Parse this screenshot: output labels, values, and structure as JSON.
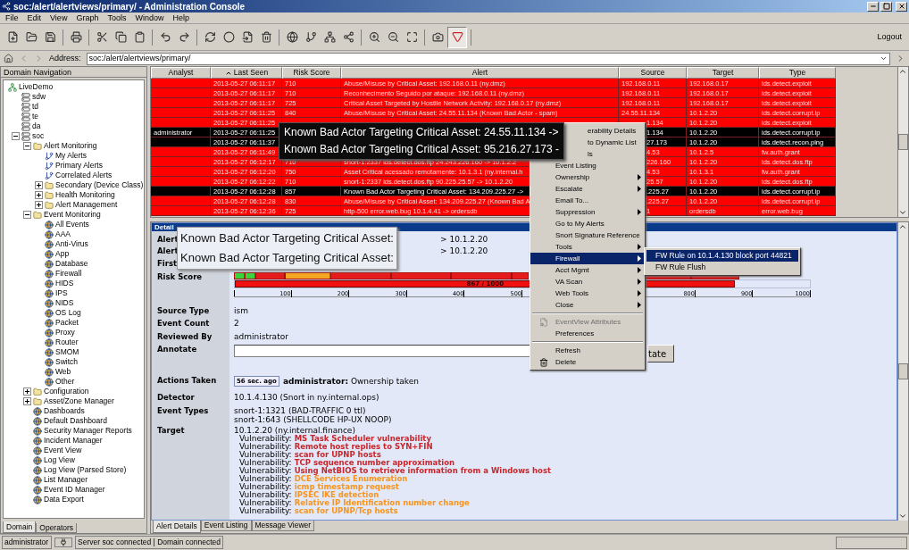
{
  "window": {
    "title": "soc:/alert/alertviews/primary/ - Administration Console"
  },
  "menubar": [
    "File",
    "Edit",
    "View",
    "Graph",
    "Tools",
    "Window",
    "Help"
  ],
  "toolbar": {
    "graph_toggle_on": true,
    "logout": "Logout"
  },
  "address": {
    "label": "Address:",
    "value": "soc:/alert/alertviews/primary/"
  },
  "navigation": {
    "title": "Domain Navigation",
    "tree": [
      {
        "label": "LiveDemo",
        "kind": "root",
        "children": [
          {
            "label": "sdw",
            "kind": "host"
          },
          {
            "label": "td",
            "kind": "host"
          },
          {
            "label": "te",
            "kind": "host"
          },
          {
            "label": "da",
            "kind": "host"
          },
          {
            "label": "soc",
            "kind": "host",
            "expanded": true,
            "children": [
              {
                "label": "Alert Monitoring",
                "kind": "folder",
                "expanded": true,
                "children": [
                  {
                    "label": "My Alerts",
                    "kind": "alert_view"
                  },
                  {
                    "label": "Primary Alerts",
                    "kind": "alert_view"
                  },
                  {
                    "label": "Correlated Alerts",
                    "kind": "alert_view"
                  },
                  {
                    "label": "Secondary (Device Class)",
                    "kind": "folder",
                    "expanded": false
                  },
                  {
                    "label": "Health Monitoring",
                    "kind": "folder",
                    "expanded": false
                  },
                  {
                    "label": "Alert Management",
                    "kind": "folder",
                    "expanded": false
                  }
                ]
              },
              {
                "label": "Event Monitoring",
                "kind": "folder",
                "expanded": true,
                "children": [
                  {
                    "label": "All Events",
                    "kind": "event_view"
                  },
                  {
                    "label": "AAA",
                    "kind": "event_view"
                  },
                  {
                    "label": "Anti-Virus",
                    "kind": "event_view"
                  },
                  {
                    "label": "App",
                    "kind": "event_view"
                  },
                  {
                    "label": "Database",
                    "kind": "event_view"
                  },
                  {
                    "label": "Firewall",
                    "kind": "event_view"
                  },
                  {
                    "label": "HIDS",
                    "kind": "event_view"
                  },
                  {
                    "label": "IPS",
                    "kind": "event_view"
                  },
                  {
                    "label": "NIDS",
                    "kind": "event_view"
                  },
                  {
                    "label": "OS Log",
                    "kind": "event_view"
                  },
                  {
                    "label": "Packet",
                    "kind": "event_view"
                  },
                  {
                    "label": "Proxy",
                    "kind": "event_view"
                  },
                  {
                    "label": "Router",
                    "kind": "event_view"
                  },
                  {
                    "label": "SMOM",
                    "kind": "event_view"
                  },
                  {
                    "label": "Switch",
                    "kind": "event_view"
                  },
                  {
                    "label": "Web",
                    "kind": "event_view"
                  },
                  {
                    "label": "Other",
                    "kind": "event_view"
                  }
                ]
              },
              {
                "label": "Configuration",
                "kind": "folder",
                "expanded": false
              },
              {
                "label": "Asset/Zone Manager",
                "kind": "folder",
                "expanded": false
              },
              {
                "label": "Dashboards",
                "kind": "event_view"
              },
              {
                "label": "Default Dashboard",
                "kind": "event_view"
              },
              {
                "label": "Security Manager Reports",
                "kind": "event_view"
              },
              {
                "label": "Incident Manager",
                "kind": "event_view"
              },
              {
                "label": "Event View",
                "kind": "event_view"
              },
              {
                "label": "Log View",
                "kind": "event_view"
              },
              {
                "label": "Log View (Parsed Store)",
                "kind": "event_view"
              },
              {
                "label": "List Manager",
                "kind": "event_view"
              },
              {
                "label": "Event ID Manager",
                "kind": "event_view"
              },
              {
                "label": "Data Export",
                "kind": "event_view"
              }
            ]
          }
        ]
      }
    ],
    "tabs": [
      {
        "label": "Domain",
        "selected": true
      },
      {
        "label": "Operators",
        "selected": false
      }
    ]
  },
  "table": {
    "columns": [
      {
        "label": "Analyst",
        "sorted": false
      },
      {
        "label": "Last Seen",
        "sorted": true
      },
      {
        "label": "Risk Score",
        "sorted": false
      },
      {
        "label": "Alert",
        "sorted": false
      },
      {
        "label": "Source",
        "sorted": false
      },
      {
        "label": "Target",
        "sorted": false
      },
      {
        "label": "Type",
        "sorted": false
      }
    ],
    "rows": [
      {
        "selected": false,
        "last_seen": "2013-05-27 06:11:17",
        "risk_score": "710",
        "alert": "Abuse/Misuse by Critical Asset: 192.168.0.11 (ny.dmz)",
        "source": "192.168.0.11",
        "target": "192.168.0.17",
        "type": "ids.detect.exploit"
      },
      {
        "selected": false,
        "last_seen": "2013-05-27 06:11:17",
        "risk_score": "710",
        "alert": "Reconhecimento Seguido por ataque: 192.168.0.11 (ny.dmz)",
        "source": "192.168.0.11",
        "target": "192.168.0.17",
        "type": "ids.detect.exploit"
      },
      {
        "selected": false,
        "last_seen": "2013-05-27 06:11:17",
        "risk_score": "725",
        "alert": "Critical Asset Targeted by Hostile Network Activity: 192.168.0.17 (ny.dmz)",
        "source": "192.168.0.11",
        "target": "192.168.0.17",
        "type": "ids.detect.exploit"
      },
      {
        "selected": false,
        "last_seen": "2013-05-27 06:11:25",
        "risk_score": "840",
        "alert": "Abuse/Misuse by Critical Asset: 24.55.11.134 (Known Bad Actor - spam)",
        "source": "24.55.11.134",
        "target": "10.1.2.20",
        "type": "ids.detect.corrupt.ip"
      },
      {
        "selected": false,
        "last_seen": "2013-05-27 06:11:25",
        "source": "1.134",
        "target": "10.1.2.20",
        "type": "ids.detect.exploit"
      },
      {
        "selected": true,
        "analyst": "administrator",
        "last_seen": "2013-05-27 06:11:25",
        "source": "1.134",
        "target": "10.1.2.20",
        "type": "ids.detect.corrupt.ip"
      },
      {
        "selected": true,
        "last_seen": "2013-05-27 06:11:37",
        "source": "27.173",
        "target": "10.1.2.20",
        "type": "ids.detect.recon.ping"
      },
      {
        "selected": false,
        "last_seen": "2013-05-27 06:11:49",
        "source": "4.53",
        "target": "10.1.2.5",
        "type": "fw.auth.grant"
      },
      {
        "selected": false,
        "last_seen": "2013-05-27 06:12:17",
        "risk_score": "710",
        "alert": "snort-1:2337 ids.detect.dos.ftp 24.243.226.160 -> 10.1.2.2",
        "source": "226.160",
        "target": "10.1.2.20",
        "type": "ids.detect.dos.ftp"
      },
      {
        "selected": false,
        "last_seen": "2013-05-27 06:12:20",
        "risk_score": "750",
        "alert": "Asset Critical acessado remotamente: 10.1.3.1 (ny.internal.h",
        "source": "4.53",
        "target": "10.1.3.1",
        "type": "fw.auth.grant"
      },
      {
        "selected": false,
        "last_seen": "2013-05-27 06:12:22",
        "risk_score": "710",
        "alert": "snort-1:2337 ids.detect.dos.ftp 90.225.25.57 -> 10.1.2.20",
        "source": "25.57",
        "target": "10.1.2.20",
        "type": "ids.detect.dos.ftp"
      },
      {
        "selected": true,
        "last_seen": "2013-05-27 06:12:28",
        "risk_score": "857",
        "alert": "Known Bad Actor Targeting Critical Asset: 134.209.225.27 ->",
        "source": ".225.27",
        "target": "10.1.2.20",
        "type": "ids.detect.corrupt.ip"
      },
      {
        "selected": false,
        "last_seen": "2013-05-27 06:12:28",
        "risk_score": "830",
        "alert": "Abuse/Misuse by Critical Asset: 134.209.225.27 (Known Bad A",
        "source": ".225.27",
        "target": "10.1.2.20",
        "type": "ids.detect.corrupt.ip"
      },
      {
        "selected": false,
        "last_seen": "2013-05-27 06:12:36",
        "risk_score": "725",
        "alert": "http-500 error.web.bug 10.1.4.41 -> ordersdb",
        "source": "1",
        "target": "ordersdb",
        "type": "error.web.bug"
      }
    ]
  },
  "details": {
    "title": "Detail",
    "rows": [
      {
        "kind": "covered",
        "label": "Alert",
        "value": "> 10.1.2.20"
      },
      {
        "kind": "covered",
        "label": "Alert",
        "value": "> 10.1.2.20"
      },
      {
        "kind": "covered",
        "label": "First"
      },
      {
        "kind": "meter",
        "label": "Risk Score",
        "level": 0.867,
        "reading": "867 / 1000",
        "ticks": [
          "100",
          "200",
          "300",
          "400",
          "500",
          "800",
          "900",
          "1000"
        ]
      },
      {
        "kind": "text",
        "label": "Source Type",
        "value": "ism"
      },
      {
        "kind": "text",
        "label": "Event Count",
        "value": "2"
      },
      {
        "kind": "text",
        "label": "Reviewed By",
        "value": "administrator"
      },
      {
        "kind": "annotate",
        "label": "Annotate",
        "button": "tate"
      },
      {
        "kind": "actions",
        "label": "Actions Taken",
        "age": "56 sec. ago",
        "value": "**administrator:** Ownership taken"
      },
      {
        "kind": "text",
        "label": "Detector",
        "value": "10.1.4.130 (Snort in ny.internal.ops)"
      },
      {
        "kind": "lines",
        "label": "Event Types",
        "lines": [
          "snort-1:1321 (BAD-TRAFFIC 0 ttl)",
          "snort-1:643 (SHELLCODE HP-UX NOOP)"
        ]
      },
      {
        "kind": "target",
        "label": "Target",
        "value": "10.1.2.20 (ny.internal.finance)",
        "vulnerabilities": [
          {
            "label": "Vulnerability:",
            "name": "MS Task Scheduler vulnerability",
            "color": "#c8262b"
          },
          {
            "label": "Vulnerability:",
            "name": "Remote host replies to SYN+FIN",
            "color": "#c8262b"
          },
          {
            "label": "Vulnerability:",
            "name": "scan for UPNP hosts",
            "color": "#c8262b"
          },
          {
            "label": "Vulnerability:",
            "name": "TCP sequence number approximation",
            "color": "#c8262b"
          },
          {
            "label": "Vulnerability:",
            "name": "Using NetBIOS to retrieve information from a Windows host",
            "color": "#c8262b"
          },
          {
            "label": "Vulnerability:",
            "name": "DCE Services Enumeration",
            "color": "#f7941d"
          },
          {
            "label": "Vulnerability:",
            "name": "icmp timestamp request",
            "color": "#f7941d"
          },
          {
            "label": "Vulnerability:",
            "name": "IPSEC IKE detection",
            "color": "#f7941d"
          },
          {
            "label": "Vulnerability:",
            "name": "Relative IP Identification number change",
            "color": "#f7941d"
          },
          {
            "label": "Vulnerability:",
            "name": "scan for UPNP/Tcp hosts",
            "color": "#f7941d"
          }
        ]
      }
    ]
  },
  "detail_tabs": [
    {
      "label": "Alert Details",
      "selected": true
    },
    {
      "label": "Event Listing",
      "selected": false
    },
    {
      "label": "Message Viewer",
      "selected": false
    }
  ],
  "tooltips": [
    {
      "kind": "dark",
      "lines": [
        "Known Bad Actor Targeting Critical Asset: 24.55.11.134 ->",
        "Known Bad Actor Targeting Critical Asset: 95.216.27.173 -"
      ]
    },
    {
      "kind": "light",
      "lines": [
        "Known Bad Actor Targeting Critical Asset:",
        "Known Bad Actor Targeting Critical Asset:"
      ]
    }
  ],
  "context_menu": {
    "items": [
      {
        "kind": "item",
        "label": "erability Details",
        "selected": false,
        "disabled": false
      },
      {
        "kind": "item",
        "label": "to Dynamic List",
        "selected": false,
        "disabled": false
      },
      {
        "kind": "item",
        "label": "ls",
        "selected": false,
        "disabled": false
      },
      {
        "kind": "item",
        "label": "Event Listing",
        "selected": false,
        "disabled": false
      },
      {
        "kind": "submenu",
        "label": "Ownership",
        "selected": false,
        "disabled": false
      },
      {
        "kind": "submenu",
        "label": "Escalate",
        "selected": false,
        "disabled": false
      },
      {
        "kind": "item",
        "label": "Email To...",
        "selected": false,
        "disabled": false
      },
      {
        "kind": "submenu",
        "label": "Suppression",
        "selected": false,
        "disabled": false
      },
      {
        "kind": "item",
        "label": "Go to My Alerts",
        "selected": false,
        "disabled": false
      },
      {
        "kind": "item",
        "label": "Snort Signature Reference",
        "selected": false,
        "disabled": false
      },
      {
        "kind": "submenu",
        "label": "Tools",
        "selected": false,
        "disabled": false
      },
      {
        "kind": "submenu",
        "label": "Firewall",
        "selected": true,
        "disabled": false
      },
      {
        "kind": "submenu",
        "label": "Acct Mgmt",
        "selected": false,
        "disabled": false
      },
      {
        "kind": "submenu",
        "label": "VA Scan",
        "selected": false,
        "disabled": false
      },
      {
        "kind": "submenu",
        "label": "Web Tools",
        "selected": false,
        "disabled": false
      },
      {
        "kind": "submenu",
        "label": "Close",
        "selected": false,
        "disabled": false
      },
      {
        "kind": "separator"
      },
      {
        "kind": "attributes",
        "label": "EventView Attributes",
        "selected": false,
        "disabled": true
      },
      {
        "kind": "item",
        "label": "Preferences",
        "selected": false,
        "disabled": false
      },
      {
        "kind": "separator"
      },
      {
        "kind": "item",
        "label": "Refresh",
        "selected": false,
        "disabled": false
      },
      {
        "kind": "delete",
        "label": "Delete",
        "selected": false,
        "disabled": false
      }
    ],
    "submenu": [
      {
        "label": "FW Rule on 10.1.4.130 block port 44821",
        "selected": true
      },
      {
        "label": "FW Rule Flush",
        "selected": false
      }
    ]
  },
  "status_bar": {
    "user": "administrator",
    "message": "Server soc connected | Domain connected"
  }
}
